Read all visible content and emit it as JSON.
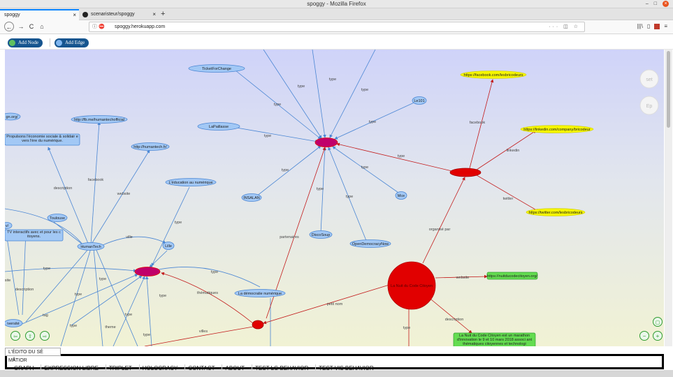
{
  "window": {
    "title": "spoggy - Mozilla Firefox",
    "min": "–",
    "max": "□",
    "close": "×"
  },
  "tabs": [
    {
      "label": "spoggy",
      "close": "×"
    },
    {
      "label": "scenaristeur/spoggy",
      "close": "×"
    }
  ],
  "new_tab": "+",
  "nav": {
    "back": "←",
    "forward": "→",
    "reload": "C",
    "home": "⌂",
    "url": "spoggy.herokuapp.com",
    "url_icons": "ⓘ ⛔",
    "page_actions": "··· ◫ ☆",
    "library": "|||\\",
    "sidebar": "▯"
  },
  "toolbar": {
    "add_node": "Add Node",
    "add_edge": "Add Edge"
  },
  "graph": {
    "nodes": {
      "ticket": "TicketForChange",
      "lapaillasse": "LaPaillasse",
      "le101": "Le101",
      "insalan": "INSALAN",
      "discosoup": "DiscoSoup",
      "mce": "Mce",
      "opendemocracy": "OpenDemocracyNow",
      "fb_lesbricodeurs": "https://facebook.com/lesbricodeurs",
      "linkedin": "https://linkedin.com/company/bricodeur",
      "twitter": "https://twitter.com/lesbricodeurs",
      "nuit_site": "https://nuitducodecitoyen.org/",
      "nuit": "La Nuit du Code Citoyen",
      "nuit_desc": "La Nuit du Code Citoyen est un marathon d'innovation le 9 et 10 mars 2018 associ ant thématiques citoyennes et technologi",
      "humantech": "HumanTech",
      "fb_humantech": "http://fb.me/humantechofficial",
      "web_humantech": "http://humantech.fr/",
      "propulsons": "Propulsons l'économie sociale & solidair e vers l'ère du numérique.",
      "education": "L'éducation au numérique",
      "toulouse": "Toulouse",
      "lille": "Lille",
      "tv": "TV interactifs avec et pour les c itoyens.",
      "democratie": "La démocratie numérique",
      "diversite": "iversité",
      "gnorg": "gn.org/",
      "vtag": "v/",
      "site": "site"
    },
    "edges": {
      "type": "type",
      "facebook": "facebook",
      "linkedin": "linkedin",
      "twitter": "twitter",
      "organise_par": "organisé par",
      "website": "website",
      "description": "description",
      "partenaires": "partenaires",
      "thematiques": "thématiques",
      "petit_nom": "petit nom",
      "ville": "ville",
      "tag": "tag",
      "theme": "theme",
      "villes": "villes"
    },
    "controls": {
      "right_top1": "set",
      "right_top2": "Ep",
      "zoom_fit": "▢",
      "zoom_out": "−",
      "zoom_in": "+",
      "left1": "⇦",
      "left2": "⇧",
      "left3": "⇨"
    }
  },
  "tooltip": "L'ÉDITO DU SÉ MATIOR",
  "footer": {
    "prefix": "/l",
    "menu": [
      "GRAPH",
      "EXPRESSION LIBRE",
      "TRIPLET",
      "HOLOCRACY",
      "CONTACT",
      "ABOUT",
      "TEST LG BEHAVIOR",
      "TEST VIS BEHAVIOR"
    ]
  },
  "colors": {
    "node_blue": "#a2c8f5",
    "node_blue_border": "#4a86d4",
    "node_red": "#e10000",
    "node_magenta": "#c0006a",
    "node_yellow": "#f5f500",
    "node_green": "#64dc50",
    "edge_blue": "#4a86d4",
    "edge_red": "#c31b1b"
  }
}
